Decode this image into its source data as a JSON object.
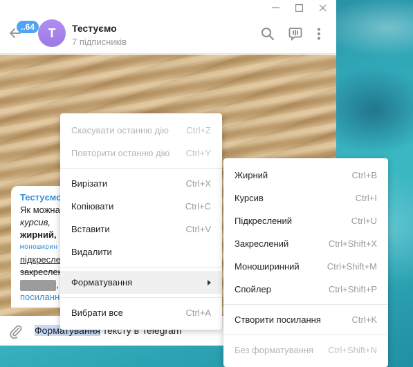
{
  "window": {
    "minimize": "—",
    "maximize": "☐",
    "close": "✕"
  },
  "header": {
    "back_badge": "..64",
    "avatar_letter": "Т",
    "title": "Тестуємо",
    "subtitle": "7 підписників"
  },
  "message": {
    "author": "Тестуємо",
    "line1": "Як можна",
    "line2": "курсив,",
    "line3": "жирний,",
    "line4": "моноширин",
    "line5": "підкреслe",
    "line6": "закреслен",
    "line7_suffix": ",",
    "line8": "посиланн"
  },
  "composer": {
    "selected_text": "Форматування",
    "rest_text": " тексту в Telegram"
  },
  "context_menu": {
    "items": [
      {
        "label": "Скасувати останню дію",
        "shortcut": "Ctrl+Z"
      },
      {
        "label": "Повторити останню дію",
        "shortcut": "Ctrl+Y"
      },
      {
        "label": "Вирізати",
        "shortcut": "Ctrl+X"
      },
      {
        "label": "Копіювати",
        "shortcut": "Ctrl+C"
      },
      {
        "label": "Вставити",
        "shortcut": "Ctrl+V"
      },
      {
        "label": "Видалити",
        "shortcut": ""
      },
      {
        "label": "Форматування",
        "shortcut": ""
      },
      {
        "label": "Вибрати все",
        "shortcut": "Ctrl+A"
      }
    ]
  },
  "format_menu": {
    "items": [
      {
        "label": "Жирний",
        "shortcut": "Ctrl+B"
      },
      {
        "label": "Курсив",
        "shortcut": "Ctrl+I"
      },
      {
        "label": "Підкреслений",
        "shortcut": "Ctrl+U"
      },
      {
        "label": "Закреслений",
        "shortcut": "Ctrl+Shift+X"
      },
      {
        "label": "Моноширинний",
        "shortcut": "Ctrl+Shift+M"
      },
      {
        "label": "Спойлер",
        "shortcut": "Ctrl+Shift+P"
      },
      {
        "label": "Створити посилання",
        "shortcut": "Ctrl+K"
      },
      {
        "label": "Без форматування",
        "shortcut": "Ctrl+Shift+N"
      }
    ]
  },
  "colors": {
    "accent": "#4ea4f6",
    "avatar": "#a383ec",
    "link": "#3a8fd6"
  }
}
